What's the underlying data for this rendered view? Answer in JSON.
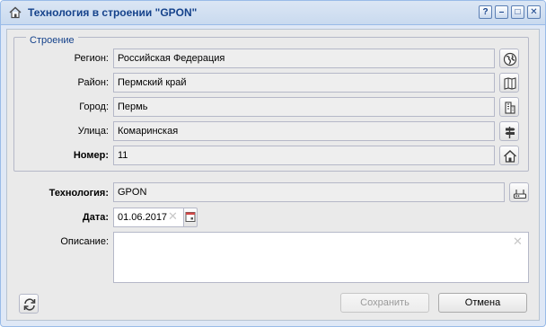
{
  "window": {
    "title": "Технология в строении \"GPON\"",
    "home_icon": "home-icon",
    "tools": [
      {
        "label": "?",
        "name": "help-button"
      },
      {
        "label": "–",
        "name": "minimize-button"
      },
      {
        "label": "□",
        "name": "maximize-button"
      },
      {
        "label": "✕",
        "name": "close-button"
      }
    ]
  },
  "building": {
    "legend": "Строение",
    "region_label": "Регион:",
    "region_value": "Российская Федерация",
    "region_icon": "globe-icon",
    "district_label": "Район:",
    "district_value": "Пермский край",
    "district_icon": "map-book-icon",
    "city_label": "Город:",
    "city_value": "Пермь",
    "city_icon": "buildings-icon",
    "street_label": "Улица:",
    "street_value": "Комаринская",
    "street_icon": "signpost-icon",
    "number_label": "Номер:",
    "number_value": "11",
    "number_icon": "house-icon"
  },
  "technology": {
    "label": "Технология:",
    "value": "GPON",
    "icon": "router-icon"
  },
  "date": {
    "label": "Дата:",
    "value": "01.06.2017",
    "clear": "✕",
    "icon": "calendar-icon"
  },
  "description": {
    "label": "Описание:",
    "value": "",
    "clear": "✕"
  },
  "footer": {
    "refresh_icon": "refresh-icon",
    "save_label": "Сохранить",
    "cancel_label": "Отмена"
  },
  "colors": {
    "title_text": "#15428b",
    "window_bg": "#dfe8f6",
    "panel_bg": "#eaeaea",
    "field_border": "#b5b8c8"
  }
}
